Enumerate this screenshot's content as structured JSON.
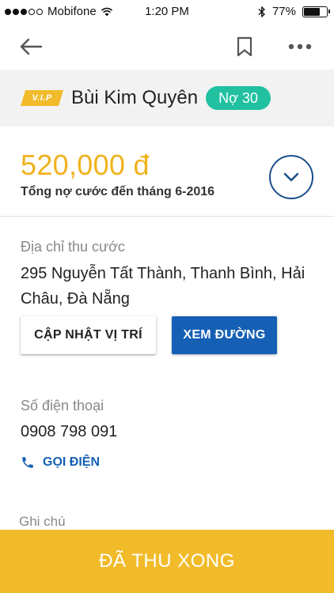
{
  "status_bar": {
    "carrier": "Mobifone",
    "signal_bars_filled": 3,
    "signal_bars_total": 5,
    "time": "1:20 PM",
    "battery_percent": "77%",
    "battery_level": 0.77
  },
  "nav": {
    "back_icon": "arrow-left-icon",
    "bookmark_icon": "bookmark-icon",
    "more_icon": "more-horizontal-icon"
  },
  "customer": {
    "vip_label": "V.I.P",
    "name": "Bùi Kim Quyên",
    "debt_badge": "Nợ 30"
  },
  "billing": {
    "amount": "520,000 đ",
    "caption": "Tổng nợ cước đến tháng 6-2016"
  },
  "address": {
    "label": "Địa chỉ thu cước",
    "value": "295 Nguyễn Tất Thành, Thanh Bình, Hải Châu, Đà Nẵng",
    "update_button": "CẬP NHẬT VỊ TRÍ",
    "route_button": "XEM ĐƯỜNG"
  },
  "phone": {
    "label": "Số điện thoại",
    "value": "0908 798 091",
    "call_label": "GỌI ĐIỆN"
  },
  "note": {
    "label": "Ghi chú"
  },
  "footer": {
    "done_label": "ĐÃ THU XONG"
  },
  "colors": {
    "accent_yellow": "#f1bb2a",
    "amount_yellow": "#f0b31e",
    "primary_blue": "#1560b5",
    "badge_teal": "#20c0a0"
  }
}
